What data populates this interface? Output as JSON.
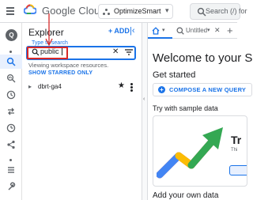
{
  "topbar": {
    "brand": "Google Cloud",
    "project": "OptimizeSmart",
    "search_placeholder": "Search (/) for"
  },
  "rail": {
    "logo_text": "Q"
  },
  "explorer": {
    "title": "Explorer",
    "add_label": "+ ADD",
    "search_label": "Type to search",
    "search_value": "public",
    "viewing_note": "Viewing workspace resources.",
    "starred_label": "SHOW STARRED ONLY",
    "tree": [
      {
        "name": "dbrt-ga4"
      }
    ]
  },
  "editor": {
    "tabs": [
      {
        "name": "home"
      },
      {
        "name": "Untitled"
      }
    ],
    "welcome_title": "Welcome to your SQ",
    "get_started": "Get started",
    "compose_label": "COMPOSE A NEW QUERY",
    "try_sample": "Try with sample data",
    "card_title": "Tr",
    "card_sub": "Thi",
    "add_own_data": "Add your own data"
  },
  "colors": {
    "accent": "#1a73e8",
    "annotation": "#d62828",
    "text": "#202124",
    "muted": "#5f6368"
  }
}
